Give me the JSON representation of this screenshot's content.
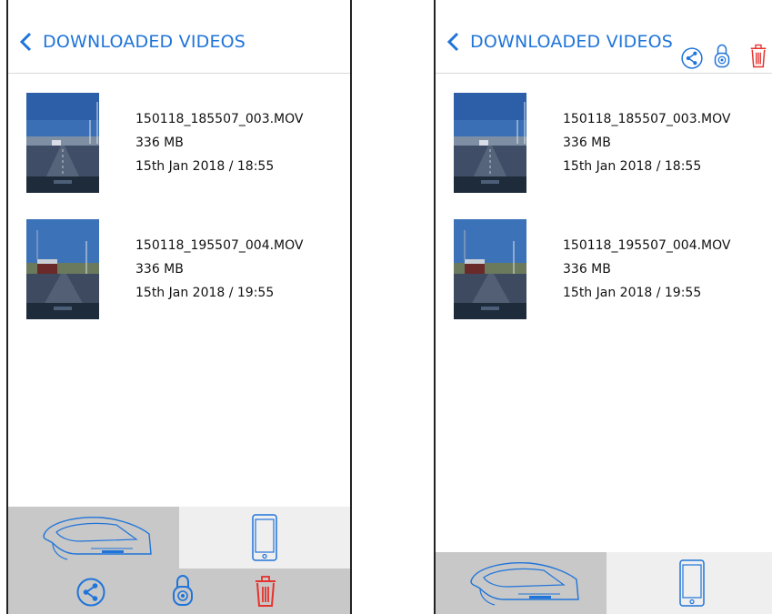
{
  "colors": {
    "accent": "#1f74d9",
    "delete": "#e5322d",
    "tab_active_bg": "#c8c8c8",
    "tab_inactive_bg": "#efefef"
  },
  "left_screen": {
    "header": {
      "title": "DOWNLOADED VIDEOS",
      "back_icon": "chevron-left-icon"
    },
    "videos": [
      {
        "filename": "150118_185507_003.MOV",
        "size": "336 MB",
        "date": "15th Jan 2018 / 18:55"
      },
      {
        "filename": "150118_195507_004.MOV",
        "size": "336 MB",
        "date": "15th Jan 2018 / 19:55"
      }
    ],
    "tabs": [
      {
        "label": "",
        "icon": "dashcam-icon",
        "active": true
      },
      {
        "label": "",
        "icon": "phone-icon",
        "active": false
      }
    ],
    "actions": [
      {
        "label": "",
        "icon": "share-icon"
      },
      {
        "label": "",
        "icon": "lock-icon"
      },
      {
        "label": "",
        "icon": "trash-icon"
      }
    ]
  },
  "right_screen": {
    "header": {
      "title": "DOWNLOADED VIDEOS",
      "back_icon": "chevron-left-icon",
      "actions": [
        {
          "label": "",
          "icon": "share-icon"
        },
        {
          "label": "",
          "icon": "lock-icon"
        },
        {
          "label": "",
          "icon": "trash-icon"
        }
      ]
    },
    "videos": [
      {
        "filename": "150118_185507_003.MOV",
        "size": "336 MB",
        "date": "15th Jan 2018 / 18:55"
      },
      {
        "filename": "150118_195507_004.MOV",
        "size": "336 MB",
        "date": "15th Jan 2018 / 19:55"
      }
    ],
    "tabs": [
      {
        "label": "",
        "icon": "dashcam-icon",
        "active": true
      },
      {
        "label": "",
        "icon": "phone-icon",
        "active": false
      }
    ]
  }
}
